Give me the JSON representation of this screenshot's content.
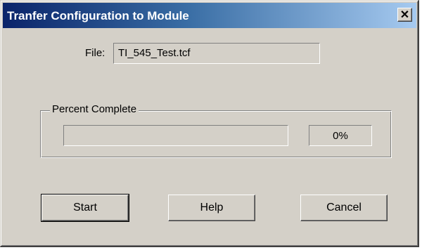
{
  "window": {
    "title": "Tranfer Configuration to Module",
    "close_glyph": "✕",
    "close_icon": "close-icon"
  },
  "file": {
    "label": "File:",
    "value": "TI_545_Test.tcf"
  },
  "progress": {
    "group_label": "Percent Complete",
    "fraction": 0,
    "percent_text": "0%",
    "fill_color": "#0a246a"
  },
  "buttons": {
    "start": "Start",
    "help": "Help",
    "cancel": "Cancel"
  },
  "colors": {
    "dialog_face": "#d4d0c8",
    "title_start": "#0a246a",
    "title_end": "#a6caf0"
  }
}
